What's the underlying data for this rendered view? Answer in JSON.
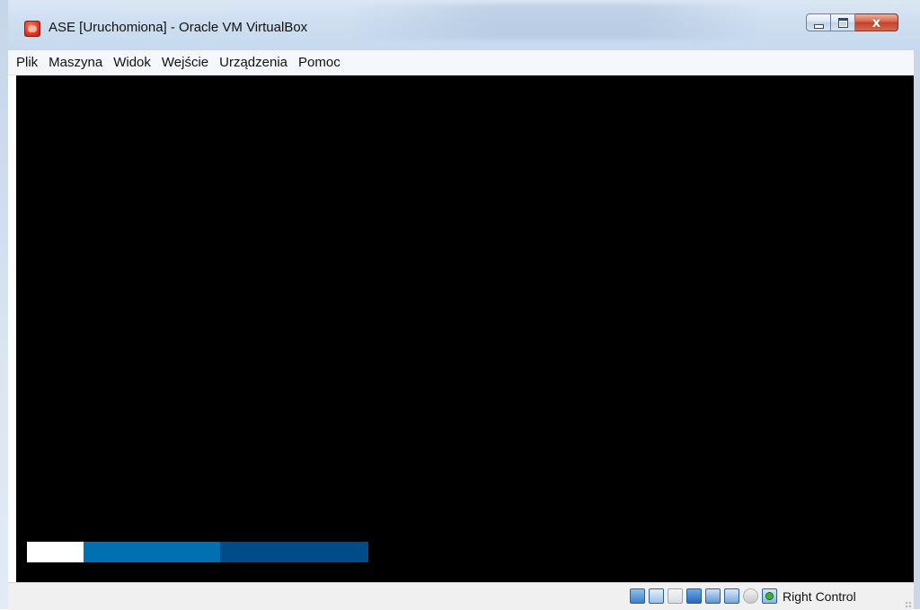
{
  "window": {
    "title": "ASE [Uruchomiona] - Oracle VM VirtualBox",
    "controls": {
      "minimize_icon": "minimize-icon",
      "maximize_icon": "maximize-icon",
      "close_icon": "close-icon",
      "close_glyph": "x"
    }
  },
  "menu": {
    "items": [
      "Plik",
      "Maszyna",
      "Widok",
      "Wejście",
      "Urządzenia",
      "Pomoc"
    ]
  },
  "vm_screen": {
    "background": "#000000",
    "boot_progress": {
      "segments": [
        {
          "color": "#ffffff",
          "share": 0.167
        },
        {
          "color": "#0070b0",
          "share": 0.4
        },
        {
          "color": "#004c88",
          "share": 0.433
        }
      ]
    }
  },
  "statusbar": {
    "icons": [
      "hard-disk-icon",
      "network-icon",
      "shared-folder-icon",
      "display-icon",
      "usb-icon",
      "virtualization-icon",
      "mouse-integration-icon",
      "host-key-arrow-icon"
    ],
    "host_key_label": "Right Control"
  },
  "colors": {
    "titlebar": "#cfdff1",
    "menubar": "#f4f7fb",
    "statusbar": "#f0f0f0",
    "close_button": "#c4412a"
  }
}
